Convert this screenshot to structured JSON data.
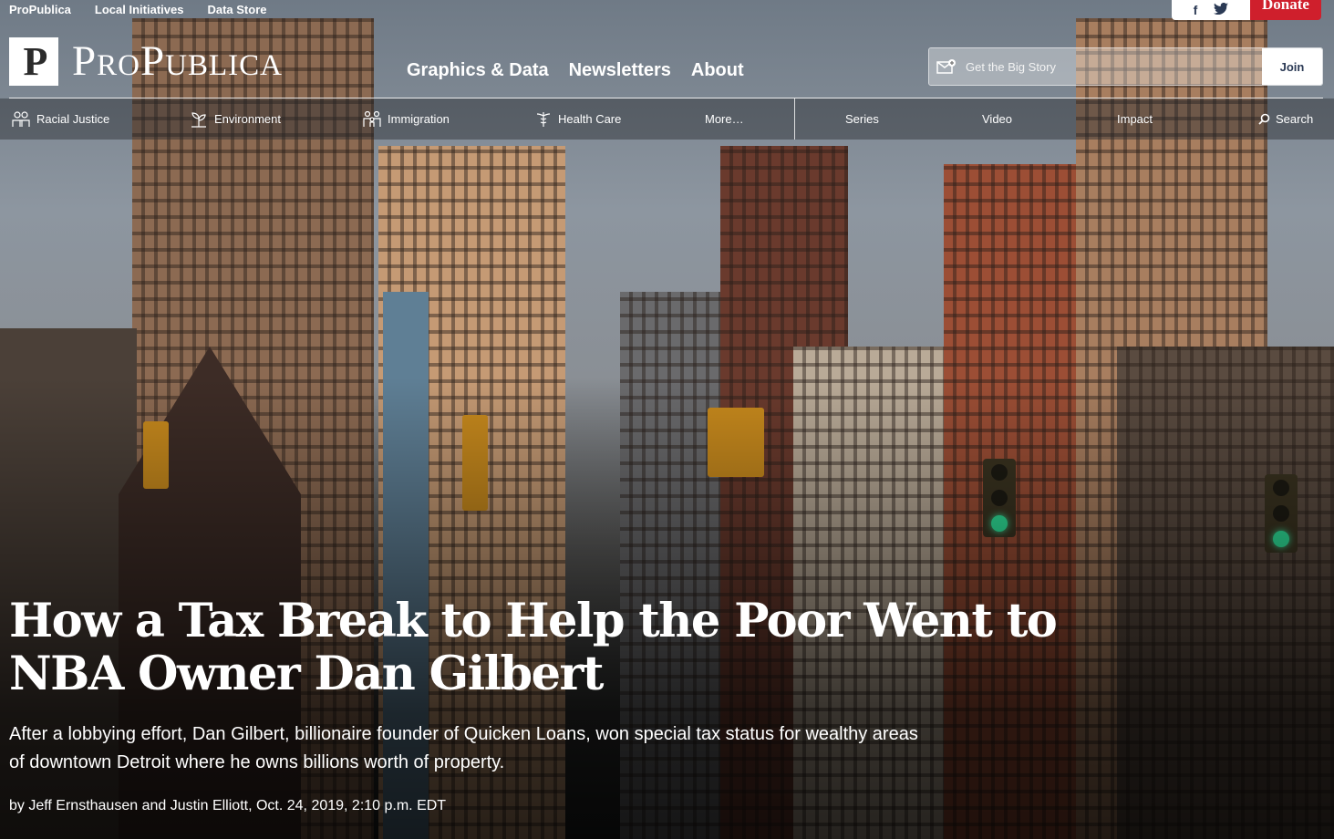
{
  "utility": {
    "links": [
      "ProPublica",
      "Local Initiatives",
      "Data Store"
    ],
    "social": [
      "facebook-icon",
      "twitter-icon"
    ],
    "donate_label": "Donate"
  },
  "logo": {
    "mark": "P",
    "name": "ProPublica"
  },
  "primary_nav": [
    "Graphics & Data",
    "Newsletters",
    "About"
  ],
  "signup": {
    "placeholder": "Get the Big Story",
    "button": "Join"
  },
  "subnav": {
    "topics": [
      {
        "label": "Racial Justice",
        "icon": "people-icon"
      },
      {
        "label": "Environment",
        "icon": "leaf-icon"
      },
      {
        "label": "Immigration",
        "icon": "family-icon"
      },
      {
        "label": "Health Care",
        "icon": "caduceus-icon"
      }
    ],
    "more": "More…",
    "sections": [
      "Series",
      "Video",
      "Impact"
    ],
    "search": "Search"
  },
  "article": {
    "headline": "How a Tax Break to Help the Poor Went to NBA Owner Dan Gilbert",
    "dek": "After a lobbying effort, Dan Gilbert, billionaire founder of Quicken Loans, won special tax status for wealthy areas of downtown Detroit where he owns billions worth of property.",
    "byline": "by Jeff Ernsthausen and Justin Elliott, Oct. 24, 2019, 2:10 p.m. EDT"
  },
  "colors": {
    "donate": "#cf1f2c",
    "nav_text": "#ffffff",
    "join_text": "#2b3a55"
  }
}
